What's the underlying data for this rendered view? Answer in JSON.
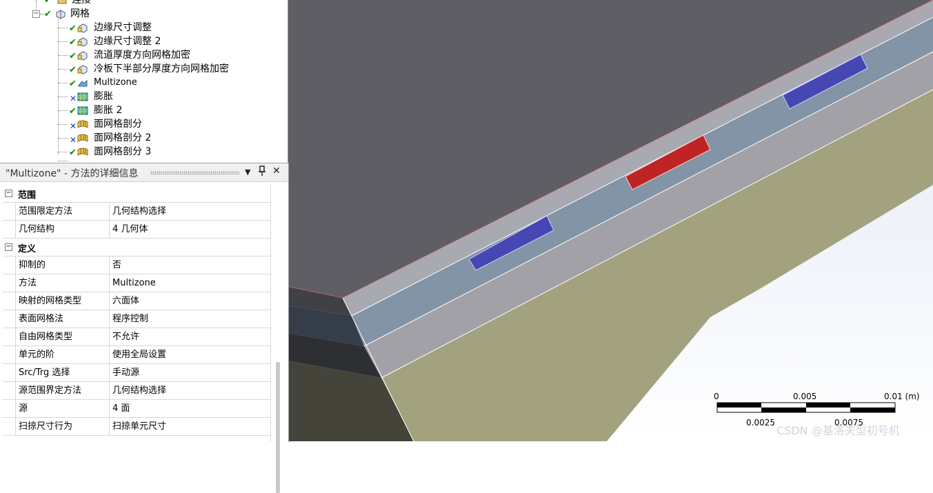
{
  "tree": {
    "partial_top": "连接",
    "mesh": "网格",
    "items": [
      {
        "label": "边缘尺寸调整",
        "status": "check",
        "icon": "sizing-icon"
      },
      {
        "label": "边缘尺寸调整 2",
        "status": "check",
        "icon": "sizing-icon"
      },
      {
        "label": "流道厚度方向网格加密",
        "status": "check",
        "icon": "sizing-icon"
      },
      {
        "label": "冷板下半部分厚度方向网格加密",
        "status": "check",
        "icon": "sizing-icon"
      },
      {
        "label": "Multizone",
        "status": "check",
        "icon": "multizone-icon"
      },
      {
        "label": "膨胀",
        "status": "x",
        "icon": "inflation-icon"
      },
      {
        "label": "膨胀 2",
        "status": "check",
        "icon": "inflation-icon"
      },
      {
        "label": "面网格剖分",
        "status": "x",
        "icon": "face-meshing-icon"
      },
      {
        "label": "面网格剖分 2",
        "status": "x",
        "icon": "face-meshing-icon"
      },
      {
        "label": "面网格剖分 3",
        "status": "check",
        "icon": "face-meshing-icon"
      }
    ]
  },
  "details": {
    "title": "\"Multizone\" - 方法的详细信息",
    "pin": "↕",
    "close": "✕",
    "groups": [
      {
        "label": "范围",
        "rows": [
          {
            "key": "范围限定方法",
            "value": "几何结构选择"
          },
          {
            "key": "几何结构",
            "value": "4 几何体"
          }
        ]
      },
      {
        "label": "定义",
        "rows": [
          {
            "key": "抑制的",
            "value": "否"
          },
          {
            "key": "方法",
            "value": "Multizone"
          },
          {
            "key": "映射的网格类型",
            "value": "六面体"
          },
          {
            "key": "表面网格法",
            "value": "程序控制"
          },
          {
            "key": "自由网格类型",
            "value": "不允许"
          },
          {
            "key": "单元的阶",
            "value": "使用全局设置"
          },
          {
            "key": "Src/Trg 选择",
            "value": "手动源"
          },
          {
            "key": "源范围界定方法",
            "value": "几何结构选择"
          },
          {
            "key": "源",
            "value": "4 面"
          },
          {
            "key": "扫掠尺寸行为",
            "value": "扫掠单元尺寸"
          }
        ]
      }
    ]
  },
  "scale_bar": {
    "top_labels": [
      "0",
      "0.005",
      "0.01 (m)"
    ],
    "bottom_labels": [
      "0.0025",
      "0.0075"
    ]
  },
  "watermark": "CSDN @基洛夫型初号机",
  "colors": {
    "selected_face": "#bf2424",
    "other_faces": "#4747b4",
    "top_surface": "#5f5e64",
    "side_surface": "#a3a27e"
  }
}
